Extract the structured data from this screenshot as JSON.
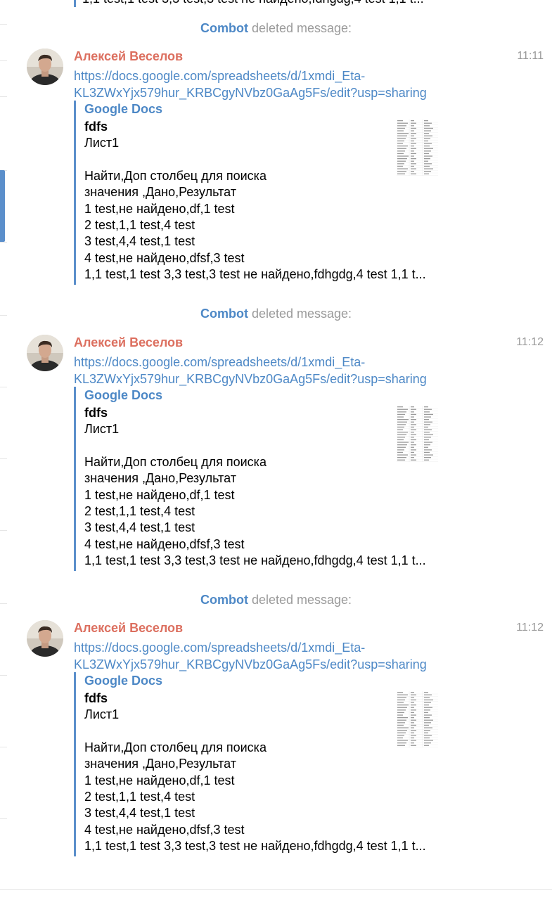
{
  "top_cut_text": "1,1 test,1 test 3,3 test,3 test не найдено,fdhgdg,4 test 1,1 t...",
  "service_messages": [
    {
      "actor": "Combot",
      "action": " deleted message:"
    },
    {
      "actor": "Combot",
      "action": " deleted message:"
    },
    {
      "actor": "Combot",
      "action": " deleted message:"
    }
  ],
  "messages": [
    {
      "author": "Алексей Веселов",
      "time": "11:11",
      "link_line1": "https://docs.google.com/spreadsheets/d/1xmdi_Eta-",
      "link_line2": "KL3ZWxYjx579hur_KRBCgyNVbz0GaAg5Fs/edit?usp=sharing",
      "preview": {
        "site": "Google Docs",
        "title": "fdfs",
        "lines": [
          "Лист1",
          "",
          "Найти,Доп столбец для поиска",
          "значения ,Дано,Результат",
          "1 test,не найдено,df,1 test",
          "2 test,1,1 test,4 test",
          "3 test,4,4 test,1 test",
          "4 test,не найдено,dfsf,3 test",
          "1,1 test,1 test 3,3 test,3 test не найдено,fdhgdg,4 test 1,1 t..."
        ]
      }
    },
    {
      "author": "Алексей Веселов",
      "time": "11:12",
      "link_line1": "https://docs.google.com/spreadsheets/d/1xmdi_Eta-",
      "link_line2": "KL3ZWxYjx579hur_KRBCgyNVbz0GaAg5Fs/edit?usp=sharing",
      "preview": {
        "site": "Google Docs",
        "title": "fdfs",
        "lines": [
          "Лист1",
          "",
          "Найти,Доп столбец для поиска",
          "значения ,Дано,Результат",
          "1 test,не найдено,df,1 test",
          "2 test,1,1 test,4 test",
          "3 test,4,4 test,1 test",
          "4 test,не найдено,dfsf,3 test",
          "1,1 test,1 test 3,3 test,3 test не найдено,fdhgdg,4 test 1,1 t..."
        ]
      }
    },
    {
      "author": "Алексей Веселов",
      "time": "11:12",
      "link_line1": "https://docs.google.com/spreadsheets/d/1xmdi_Eta-",
      "link_line2": "KL3ZWxYjx579hur_KRBCgyNVbz0GaAg5Fs/edit?usp=sharing",
      "preview": {
        "site": "Google Docs",
        "title": "fdfs",
        "lines": [
          "Лист1",
          "",
          "Найти,Доп столбец для поиска",
          "значения ,Дано,Результат",
          "1 test,не найдено,df,1 test",
          "2 test,1,1 test,4 test",
          "3 test,4,4 test,1 test",
          "4 test,не найдено,dfsf,3 test",
          "1,1 test,1 test 3,3 test,3 test не найдено,fdhgdg,4 test 1,1 t..."
        ]
      }
    }
  ],
  "colors": {
    "author": "#dc6f5f",
    "link": "#4d88c6",
    "accent_bar": "#5b8fcb",
    "muted": "#9a9a9a"
  }
}
